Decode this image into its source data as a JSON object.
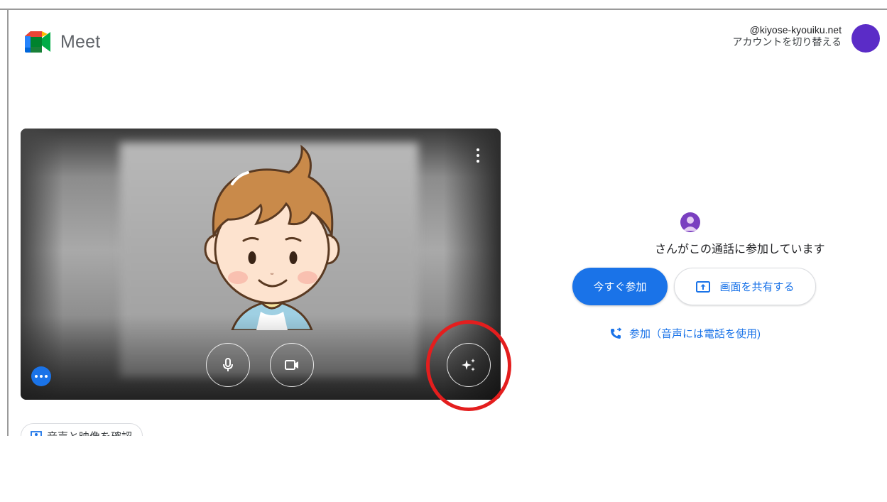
{
  "app": {
    "name": "Meet"
  },
  "account": {
    "email": "@kiyose-kyouiku.net",
    "switch_label": "アカウントを切り替える",
    "avatar_color": "#5b2cc7"
  },
  "preview": {
    "more_options_icon": "more-vert-icon",
    "mic_icon": "microphone-icon",
    "camera_icon": "videocam-icon",
    "effects_icon": "sparkle-effects-icon",
    "more_dots_icon": "more-horiz-icon"
  },
  "check_av": {
    "label": "音声と映像を確認"
  },
  "join_panel": {
    "joined_text": "さんがこの通話に参加しています",
    "join_now_label": "今すぐ参加",
    "share_screen_label": "画面を共有する",
    "phone_join_label": "参加（音声には電話を使用)"
  },
  "colors": {
    "accent": "#1a73e8",
    "highlight_circle": "#e41e1e"
  }
}
